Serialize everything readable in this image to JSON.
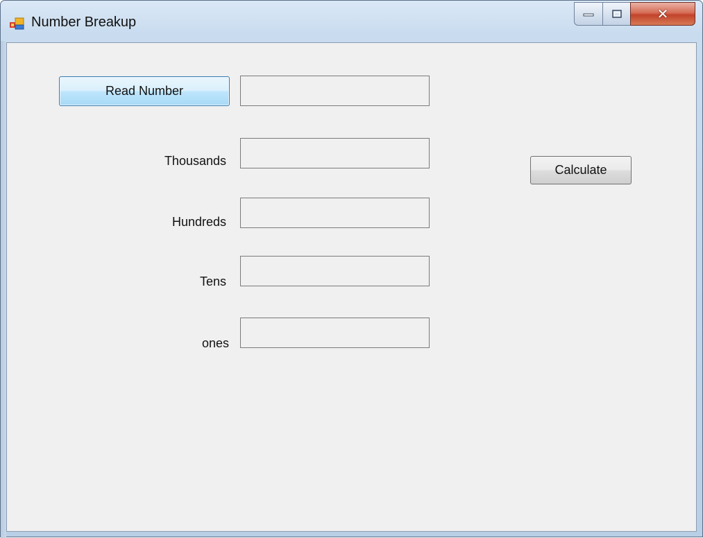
{
  "window": {
    "title": "Number Breakup",
    "controls": {
      "minimize_icon": "minimize-icon",
      "maximize_icon": "maximize-icon",
      "close_icon": "close-icon",
      "close_glyph": "✕"
    }
  },
  "form": {
    "read_number_button": "Read Number",
    "calculate_button": "Calculate",
    "number_value": "",
    "fields": [
      {
        "label": "Thousands",
        "value": ""
      },
      {
        "label": "Hundreds",
        "value": ""
      },
      {
        "label": "Tens",
        "value": ""
      },
      {
        "label": "ones",
        "value": ""
      }
    ]
  },
  "colors": {
    "client_background": "#f0f0f0",
    "focus_border": "#3c7fb1",
    "close_button": "#c2432a"
  }
}
